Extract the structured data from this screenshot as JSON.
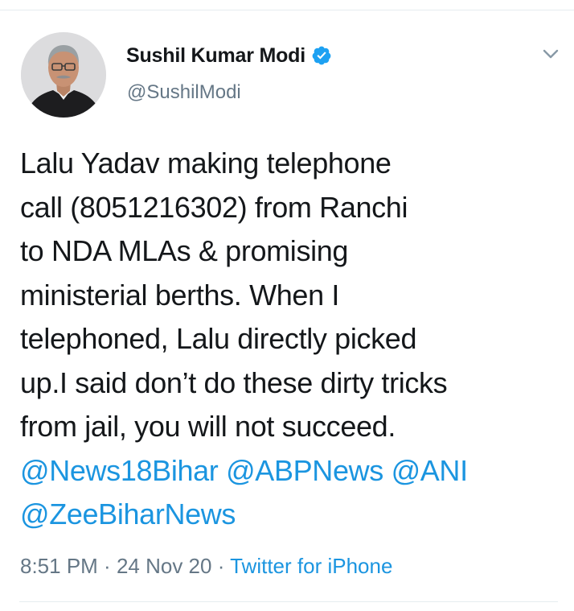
{
  "user": {
    "display_name": "Sushil Kumar Modi",
    "handle": "@SushilModi",
    "verified": true,
    "avatar_icon": "profile-photo"
  },
  "tweet": {
    "text_lines": [
      "Lalu Yadav making telephone",
      "call (8051216302) from Ranchi",
      "to NDA MLAs & promising",
      "ministerial berths. When I",
      "telephoned, Lalu directly picked",
      "up.I said don’t do these dirty tricks",
      "from jail, you will not succeed."
    ],
    "mentions": {
      "line1": [
        "@News18Bihar",
        "@ABPNews",
        "@ANI"
      ],
      "line2": [
        "@ZeeBiharNews"
      ]
    },
    "time": "8:51 PM",
    "separator": " · ",
    "date": "24 Nov 20",
    "source": "Twitter for iPhone"
  },
  "icons": {
    "verified": "verified-badge-icon",
    "menu": "chevron-down-icon"
  },
  "colors": {
    "text": "#14171a",
    "secondary": "#657786",
    "link": "#1b95e0",
    "divider": "#e6ecf0"
  }
}
